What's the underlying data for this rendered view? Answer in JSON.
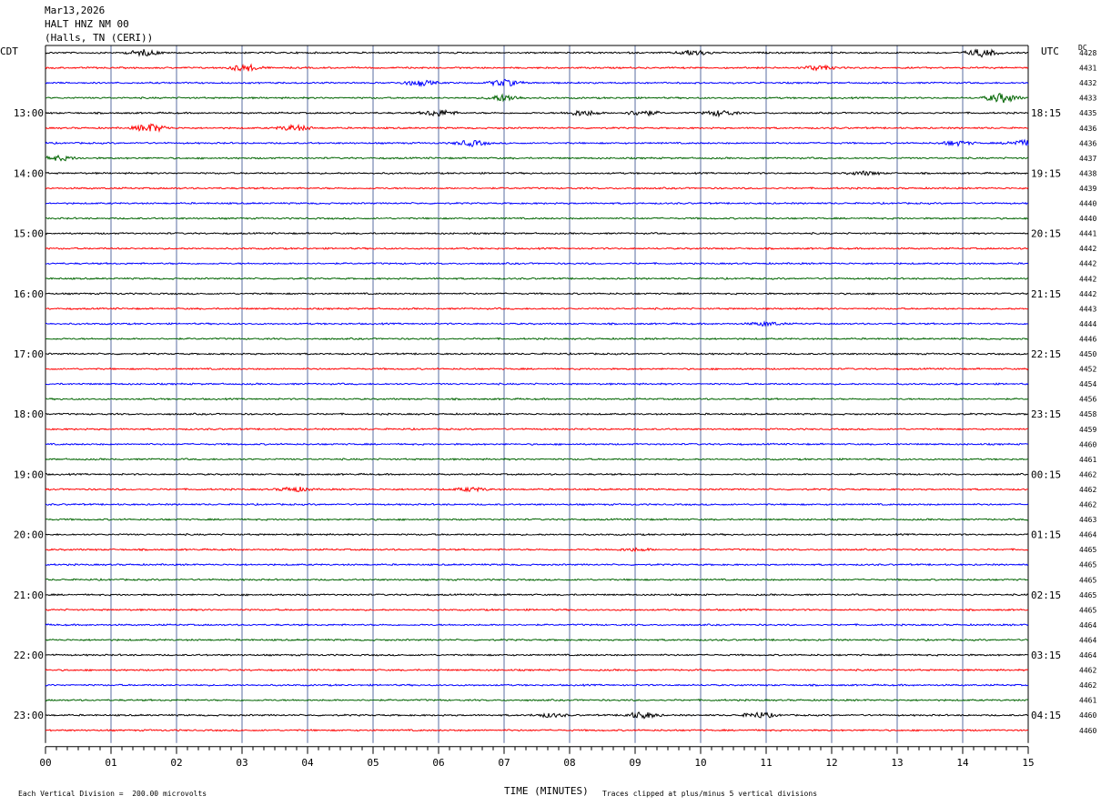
{
  "header": {
    "date": "Mar13,2026",
    "station": "HALT HNZ NM 00",
    "location": "(Halls, TN (CERI))"
  },
  "left_tz": "CDT",
  "right_tz": "UTC",
  "dc_label": "DC",
  "chart_data": {
    "type": "line",
    "subtype": "helicorder",
    "x_range": [
      0,
      15
    ],
    "xlabel": "TIME (MINUTES)",
    "x_ticks": [
      "00",
      "01",
      "02",
      "03",
      "04",
      "05",
      "06",
      "07",
      "08",
      "09",
      "10",
      "11",
      "12",
      "13",
      "14",
      "15"
    ],
    "left_hour_labels": [
      "13:00",
      "14:00",
      "15:00",
      "16:00",
      "17:00",
      "18:00",
      "19:00",
      "20:00",
      "21:00",
      "22:00",
      "23:00"
    ],
    "right_hour_labels": [
      "18:15",
      "19:15",
      "20:15",
      "21:15",
      "22:15",
      "23:15",
      "00:15",
      "01:15",
      "02:15",
      "03:15",
      "04:15"
    ],
    "trace_colors": [
      "#000000",
      "#ff0000",
      "#0000ff",
      "#006400"
    ],
    "grid_color": "#5a6ea0",
    "dc_offsets": [
      "4428",
      "4431",
      "4432",
      "4433",
      "4435",
      "4436",
      "4436",
      "4437",
      "4438",
      "4439",
      "4440",
      "4440",
      "4441",
      "4442",
      "4442",
      "4442",
      "4442",
      "4443",
      "4444",
      "4446",
      "4450",
      "4452",
      "4454",
      "4456",
      "4458",
      "4459",
      "4460",
      "4461",
      "4462",
      "4462",
      "4462",
      "4463",
      "4464",
      "4465",
      "4465",
      "4465",
      "4465",
      "4465",
      "4464",
      "4464",
      "4464",
      "4462",
      "4462",
      "4461",
      "4460",
      "4460"
    ],
    "events": [
      {
        "trace": 0,
        "minute": 1.5,
        "amp": 0.6
      },
      {
        "trace": 0,
        "minute": 9.9,
        "amp": 0.6
      },
      {
        "trace": 0,
        "minute": 14.3,
        "amp": 0.8
      },
      {
        "trace": 1,
        "minute": 3.05,
        "amp": 0.7
      },
      {
        "trace": 1,
        "minute": 11.8,
        "amp": 0.5
      },
      {
        "trace": 2,
        "minute": 5.7,
        "amp": 0.6
      },
      {
        "trace": 2,
        "minute": 7.0,
        "amp": 0.7
      },
      {
        "trace": 3,
        "minute": 7.0,
        "amp": 0.7
      },
      {
        "trace": 3,
        "minute": 14.6,
        "amp": 1.0
      },
      {
        "trace": 4,
        "minute": 6.0,
        "amp": 0.7
      },
      {
        "trace": 4,
        "minute": 8.2,
        "amp": 0.6
      },
      {
        "trace": 4,
        "minute": 9.1,
        "amp": 0.6
      },
      {
        "trace": 4,
        "minute": 10.3,
        "amp": 0.6
      },
      {
        "trace": 5,
        "minute": 1.6,
        "amp": 0.9
      },
      {
        "trace": 5,
        "minute": 3.8,
        "amp": 0.6
      },
      {
        "trace": 6,
        "minute": 6.5,
        "amp": 0.6
      },
      {
        "trace": 6,
        "minute": 13.9,
        "amp": 0.5
      },
      {
        "trace": 6,
        "minute": 14.9,
        "amp": 0.6
      },
      {
        "trace": 7,
        "minute": 0.2,
        "amp": 0.5
      },
      {
        "trace": 8,
        "minute": 12.5,
        "amp": 0.4
      },
      {
        "trace": 18,
        "minute": 11.0,
        "amp": 0.4
      },
      {
        "trace": 29,
        "minute": 3.8,
        "amp": 0.5
      },
      {
        "trace": 29,
        "minute": 6.5,
        "amp": 0.4
      },
      {
        "trace": 33,
        "minute": 9.0,
        "amp": 0.3
      },
      {
        "trace": 44,
        "minute": 9.1,
        "amp": 0.7
      },
      {
        "trace": 44,
        "minute": 10.9,
        "amp": 0.6
      },
      {
        "trace": 44,
        "minute": 7.7,
        "amp": 0.4
      }
    ]
  },
  "footer": {
    "scale": "Each Vertical Division =  200.00 microvolts",
    "clip": "Traces clipped at plus/minus 5 vertical divisions"
  }
}
